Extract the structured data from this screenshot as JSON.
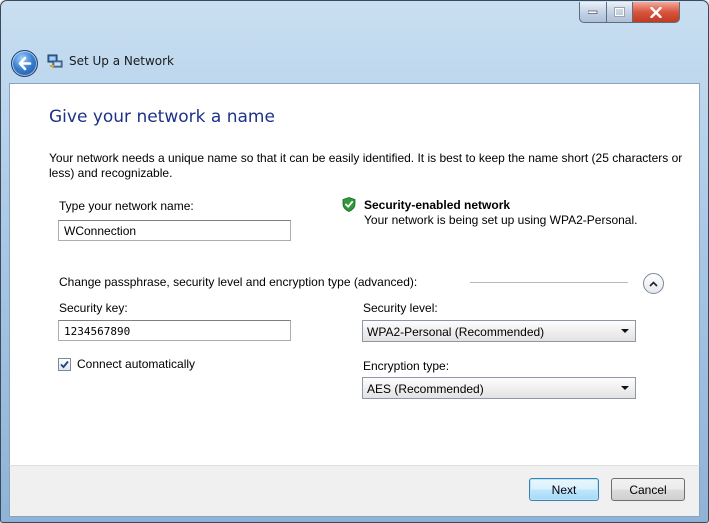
{
  "window": {
    "title": "Set Up a Network",
    "icons": {
      "back": "back-arrow-icon",
      "app": "network-setup-icon",
      "min": "minimize-icon",
      "max": "maximize-icon",
      "close": "close-icon"
    }
  },
  "main": {
    "heading": "Give your network a name",
    "description": "Your network needs a unique name so that it can be easily identified. It is best to keep the name short (25 characters or less) and recognizable.",
    "name_label": "Type your network name:",
    "name_value": "WConnection",
    "security": {
      "title": "Security-enabled network",
      "description": "Your network is being set up using WPA2-Personal.",
      "icon": "shield-check-icon"
    },
    "advanced_label": "Change passphrase, security level and encryption type (advanced):",
    "security_key_label": "Security key:",
    "security_key_value": "1234567890",
    "security_level_label": "Security level:",
    "security_level_value": "WPA2-Personal (Recommended)",
    "connect_label": "Connect automatically",
    "connect_checked": true,
    "encryption_label": "Encryption type:",
    "encryption_value": "AES (Recommended)"
  },
  "footer": {
    "next_label": "Next",
    "cancel_label": "Cancel"
  },
  "colors": {
    "heading": "#1e3287",
    "title_glass": "#a9c8e6",
    "close": "#c23a22",
    "accent": "#3c7fb1"
  }
}
